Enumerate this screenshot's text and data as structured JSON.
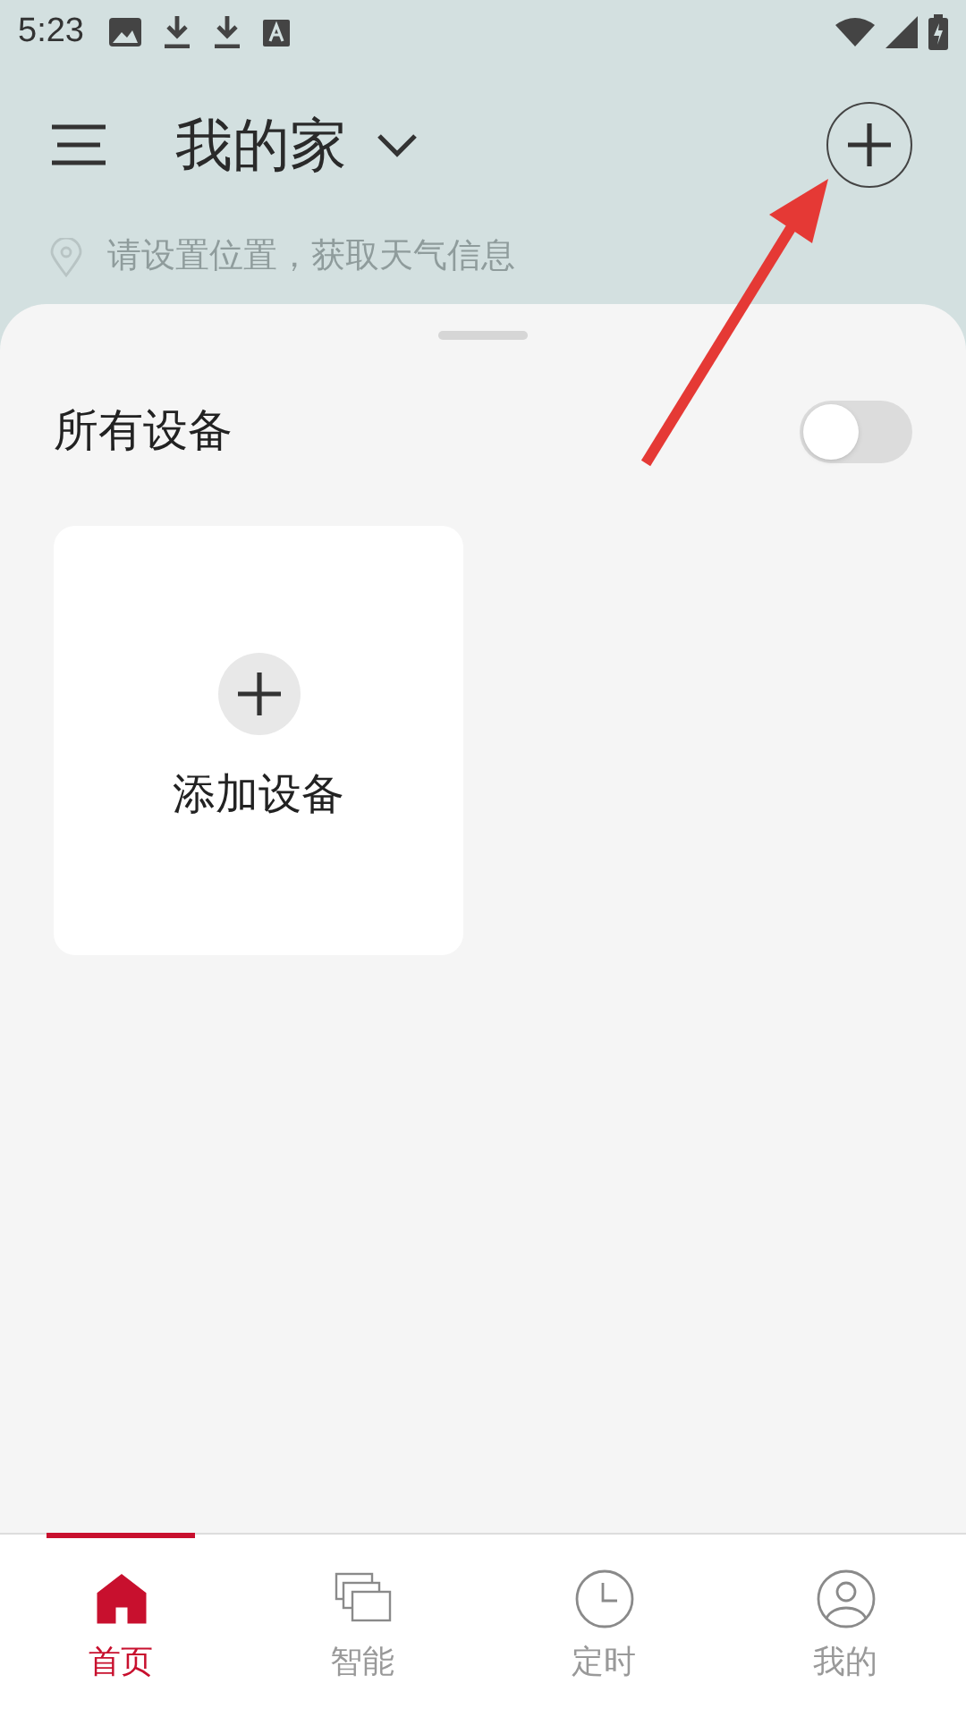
{
  "status_bar": {
    "time": "5:23"
  },
  "header": {
    "title": "我的家",
    "location_hint": "请设置位置，获取天气信息"
  },
  "section": {
    "title": "所有设备",
    "toggle": {
      "on": false
    }
  },
  "devices": [
    {
      "kind": "add",
      "label": "添加设备"
    }
  ],
  "tabs": [
    {
      "label": "首页",
      "kind": "home",
      "selected": true
    },
    {
      "label": "智能",
      "kind": "scenes",
      "selected": false
    },
    {
      "label": "定时",
      "kind": "clock",
      "selected": false
    },
    {
      "label": "我的",
      "kind": "user",
      "selected": false
    }
  ]
}
